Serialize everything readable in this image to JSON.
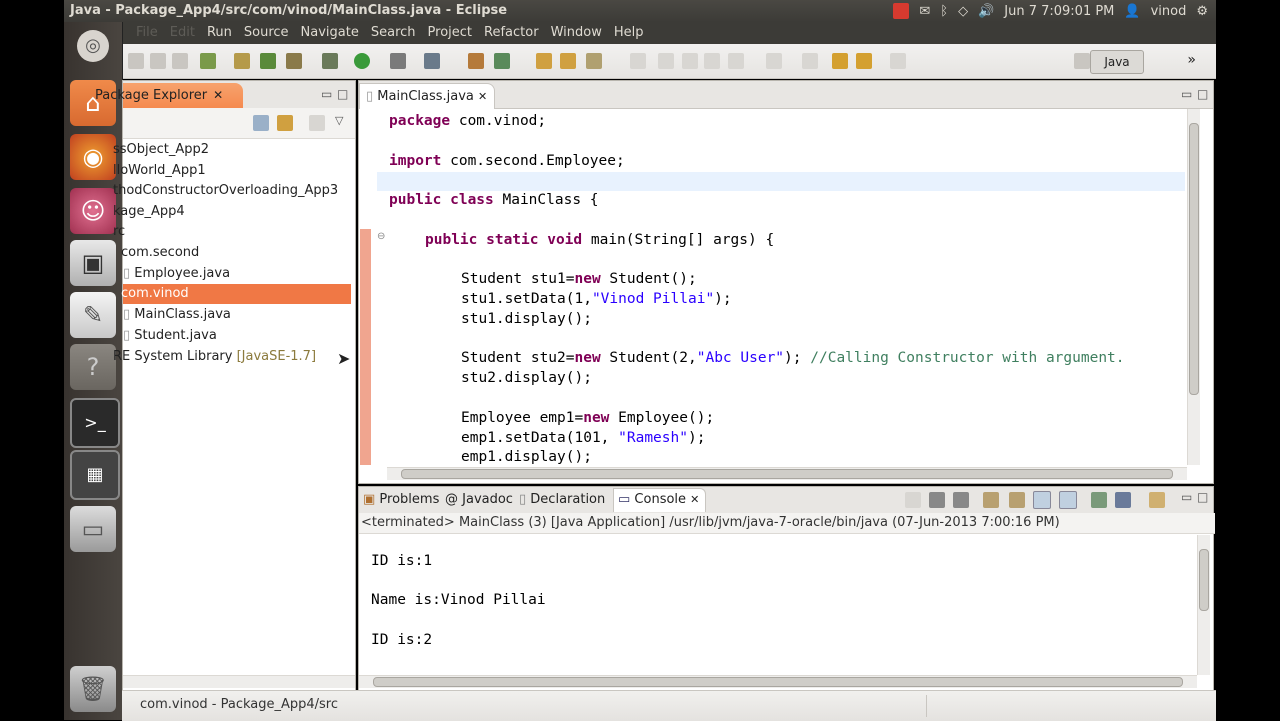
{
  "window": {
    "title": "Java - Package_App4/src/com/vinod/MainClass.java - Eclipse",
    "clock": "Jun 7 7:09:01 PM",
    "user": "vinod"
  },
  "menubar": [
    "File",
    "Edit",
    "Run",
    "Source",
    "Navigate",
    "Search",
    "Project",
    "Refactor",
    "Window",
    "Help"
  ],
  "toolbar": {
    "perspective": "Java",
    "overflow": "»"
  },
  "package_explorer": {
    "tab_label": "Package Explorer",
    "items": [
      {
        "label": "ssObject_App2"
      },
      {
        "label": "lloWorld_App1"
      },
      {
        "label": "thodConstructorOverloading_App3"
      },
      {
        "label": "kage_App4"
      },
      {
        "label": "rc"
      },
      {
        "label": "com.second"
      },
      {
        "label": "Employee.java"
      },
      {
        "label": "com.vinod",
        "selected": true
      },
      {
        "label": "MainClass.java"
      },
      {
        "label": "Student.java"
      },
      {
        "label": "RE System Library",
        "decoration": "[JavaSE-1.7]"
      }
    ]
  },
  "editor": {
    "tab_label": "MainClass.java",
    "lines": {
      "l1_kw": "package",
      "l1_rest": " com.vinod;",
      "l2_kw": "import",
      "l2_rest": " com.second.Employee;",
      "l3_kw": "public class",
      "l3_rest": " MainClass {",
      "l4_kw": "public static void",
      "l4_rest": " main(String[] args) {",
      "l5_a": "Student stu1=",
      "l5_kw": "new",
      "l5_b": " Student();",
      "l6_a": "stu1.setData(1,",
      "l6_str": "\"Vinod Pillai\"",
      "l6_b": ");",
      "l7": "stu1.display();",
      "l8_a": "Student stu2=",
      "l8_kw": "new",
      "l8_b": " Student(2,",
      "l8_str": "\"Abc User\"",
      "l8_c": "); ",
      "l8_cmt": "//Calling Constructor with argument.",
      "l9": "stu2.display();",
      "l10_a": "Employee emp1=",
      "l10_kw": "new",
      "l10_b": " Employee();",
      "l11_a": "emp1.setData(101, ",
      "l11_str": "\"Ramesh\"",
      "l11_b": ");",
      "l12": "emp1.display();"
    }
  },
  "console": {
    "tabs": [
      "Problems",
      "Javadoc",
      "Declaration",
      "Console"
    ],
    "status": "<terminated> MainClass (3) [Java Application] /usr/lib/jvm/java-7-oracle/bin/java (07-Jun-2013 7:00:16 PM)",
    "output": [
      "ID is:1",
      "Name is:Vinod Pillai",
      "ID is:2"
    ]
  },
  "statusbar": {
    "text": "com.vinod - Package_App4/src"
  }
}
